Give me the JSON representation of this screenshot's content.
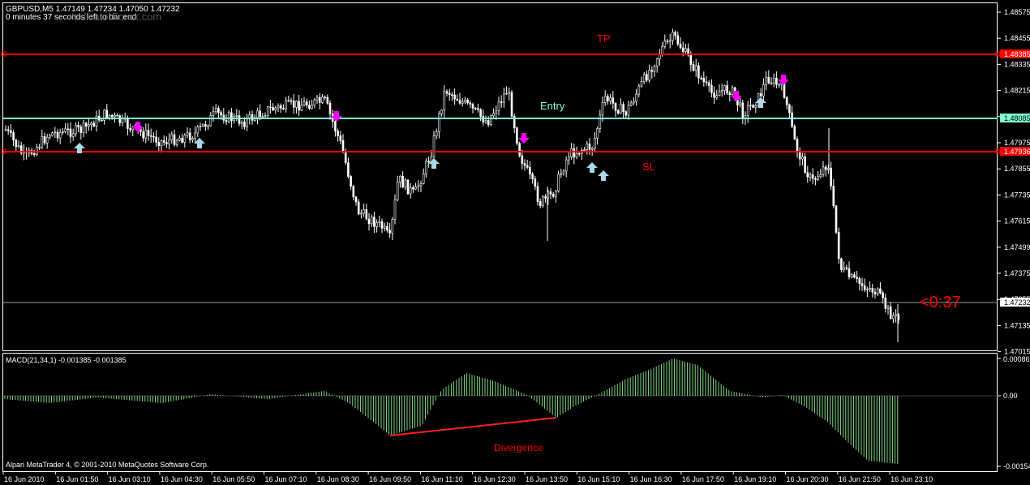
{
  "header": {
    "symbol_line": "GBPUSD,M5  1.47149 1.47234 1.47050 1.47232",
    "timer_line": "0 minutes 37 seconds left to bar end",
    "watermark": "IndicatorForex.com"
  },
  "annotations": {
    "tp": "TP",
    "entry": "Entry",
    "sl": "SL",
    "countdown": "<0:37",
    "divergence": "Divergence"
  },
  "price_axis": {
    "ticks": [
      "1.48575",
      "1.48455",
      "1.48335",
      "1.48215",
      "1.48095",
      "1.47975",
      "1.47855",
      "1.47735",
      "1.47615",
      "1.47499",
      "1.47375",
      "1.47255",
      "1.47135",
      "1.47015"
    ],
    "tp_tag": "1.48385",
    "entry_tag": "1.48085",
    "sl_tag": "1.47936",
    "bid_tag": "1.47232"
  },
  "macd": {
    "label": "MACD(21,34,1) -0.001385 -0.001385",
    "ticks": [
      "0.00086",
      "0.00",
      "-0.00154"
    ]
  },
  "time_axis": {
    "ticks": [
      "16 Jun 2010",
      "16 Jun 01:50",
      "16 Jun 03:10",
      "16 Jun 04:30",
      "16 Jun 05:50",
      "16 Jun 07:10",
      "16 Jun 08:30",
      "16 Jun 09:50",
      "16 Jun 11:10",
      "16 Jun 12:30",
      "16 Jun 13:50",
      "16 Jun 15:10",
      "16 Jun 16:30",
      "16 Jun 17:50",
      "16 Jun 19:10",
      "16 Jun 20:30",
      "16 Jun 21:50",
      "16 Jun 23:10"
    ]
  },
  "footer": {
    "copyright": "Alpari MetaTrader 4, © 2001-2010 MetaQuotes Software Corp."
  },
  "colors": {
    "background": "#000000",
    "candle": "#ffffff",
    "tp_sl_line": "#ff0000",
    "entry_line": "#7fffd4",
    "buy_arrow": "#add8e6",
    "sell_arrow": "#ff00ff",
    "macd_histogram": "#90ee90",
    "divergence_line": "#ff2020",
    "panel_border": "#ffffff"
  }
}
